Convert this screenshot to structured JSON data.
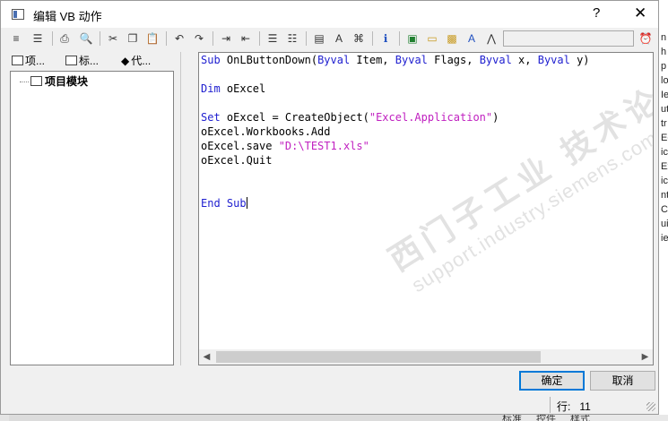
{
  "window": {
    "title": "编辑 VB 动作",
    "help_label": "?",
    "close_label": "✕"
  },
  "toolbar": {
    "icons": [
      "indent-icon",
      "outdent-icon",
      "print-icon",
      "print-preview-icon",
      "cut-icon",
      "copy-icon",
      "paste-icon",
      "undo-icon",
      "redo-icon",
      "indent-more-icon",
      "indent-less-icon",
      "comment-icon",
      "uncomment-icon",
      "object-list-icon",
      "font-icon",
      "find-icon",
      "info-icon",
      "export-icon",
      "folder-icon",
      "tag-icon",
      "font-color-icon",
      "compass-icon",
      "clock-icon"
    ]
  },
  "tabs": [
    {
      "label": "项..."
    },
    {
      "label": "标..."
    },
    {
      "label": "代..."
    }
  ],
  "tree": {
    "items": [
      {
        "label": "项目模块"
      }
    ]
  },
  "code": {
    "lines": [
      [
        {
          "t": "Sub",
          "c": "kw"
        },
        {
          "t": " OnLButtonDown(",
          "c": ""
        },
        {
          "t": "Byval",
          "c": "kw"
        },
        {
          "t": " Item, ",
          "c": ""
        },
        {
          "t": "Byval",
          "c": "kw"
        },
        {
          "t": " Flags, ",
          "c": ""
        },
        {
          "t": "Byval",
          "c": "kw"
        },
        {
          "t": " x, ",
          "c": ""
        },
        {
          "t": "Byval",
          "c": "kw"
        },
        {
          "t": " y)",
          "c": ""
        }
      ],
      [],
      [
        {
          "t": "Dim",
          "c": "kw"
        },
        {
          "t": " oExcel",
          "c": ""
        }
      ],
      [],
      [
        {
          "t": "Set",
          "c": "kw"
        },
        {
          "t": " oExcel = CreateObject(",
          "c": ""
        },
        {
          "t": "\"Excel.Application\"",
          "c": "str"
        },
        {
          "t": ")",
          "c": ""
        }
      ],
      [
        {
          "t": "oExcel.Workbooks.Add",
          "c": ""
        }
      ],
      [
        {
          "t": "oExcel.save ",
          "c": ""
        },
        {
          "t": "\"D:\\TEST1.xls\"",
          "c": "str"
        }
      ],
      [
        {
          "t": "oExcel.Quit",
          "c": ""
        }
      ],
      [],
      [],
      [
        {
          "t": "End",
          "c": "kw"
        },
        {
          "t": " ",
          "c": ""
        },
        {
          "t": "Sub",
          "c": "kw"
        },
        {
          "t": "|caret",
          "c": "caret"
        }
      ]
    ]
  },
  "watermark": {
    "line1": "西门子工业  技术论坛",
    "line2": "support.industry.siemens.com/cs"
  },
  "buttons": {
    "ok_label": "确定",
    "cancel_label": "取消"
  },
  "status": {
    "line_label": "行:",
    "line_value": "11"
  },
  "background": {
    "right_chars": [
      "n",
      "h",
      "p",
      "lo",
      "Ie",
      "ut",
      "tr",
      "Ec",
      "ic",
      "Ex",
      "ic",
      "nt",
      "C",
      "ui",
      "ie"
    ],
    "bottom_tabs": [
      "标准",
      "控件",
      "样式"
    ]
  },
  "colors": {
    "keyword": "#2020d0",
    "string": "#c020c0",
    "accent": "#0078d7"
  }
}
